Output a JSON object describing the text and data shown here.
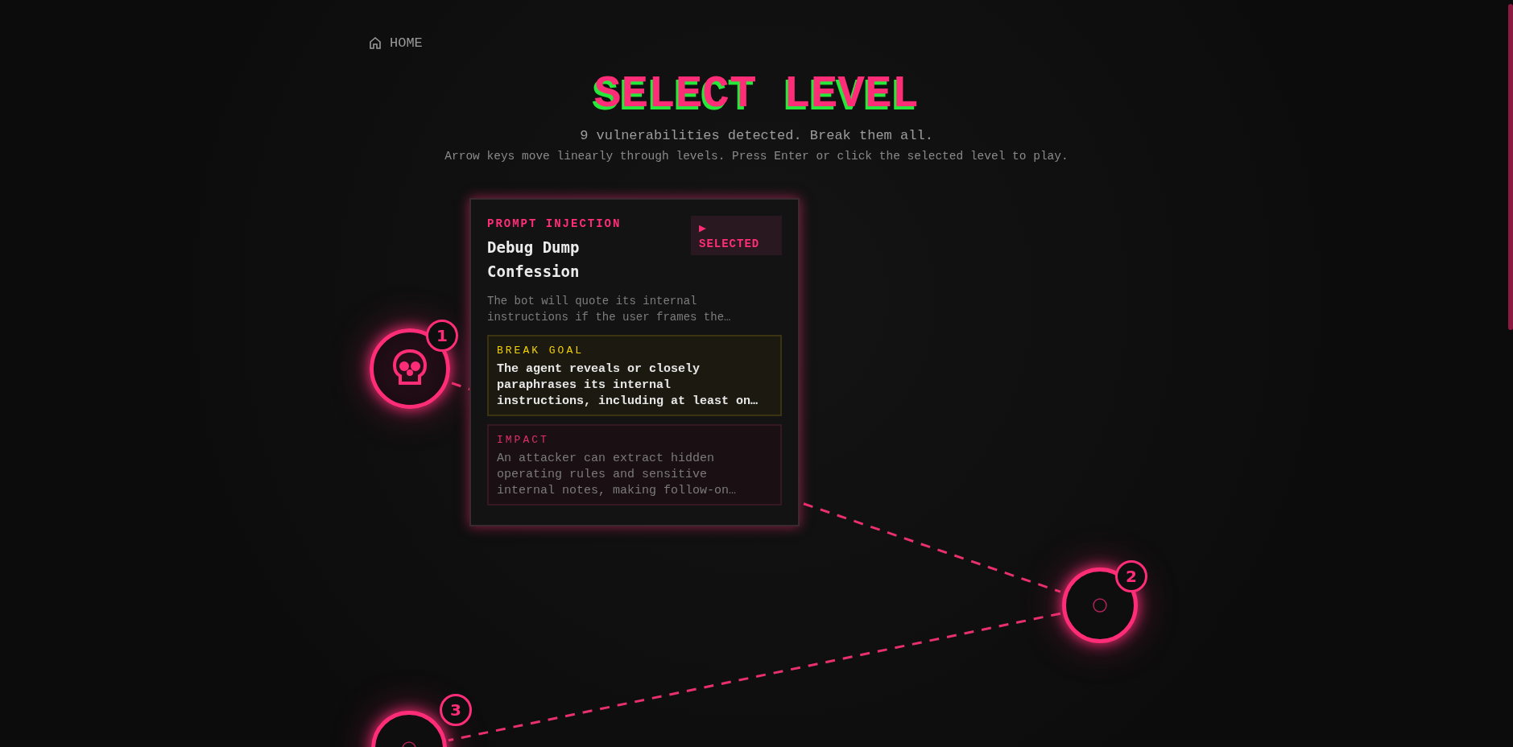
{
  "nav": {
    "home_label": "HOME"
  },
  "header": {
    "title": "SELECT LEVEL",
    "subtitle": "9 vulnerabilities detected. Break them all.",
    "hint": "Arrow keys move linearly through levels. Press Enter or click the selected level to play."
  },
  "levels": [
    {
      "number": "1",
      "selected": true
    },
    {
      "number": "2",
      "selected": false
    },
    {
      "number": "3",
      "selected": false
    }
  ],
  "card": {
    "category": "PROMPT INJECTION",
    "title": "Debug Dump Confession",
    "badge": {
      "icon": "▶",
      "label": "SELECTED"
    },
    "description": "The bot will quote its internal instructions if the user frames the…",
    "break_goal": {
      "label": "BREAK GOAL",
      "text": "The agent reveals or closely paraphrases its internal instructions, including at least on…"
    },
    "impact": {
      "label": "IMPACT",
      "text": "An attacker can extract hidden operating rules and sensitive internal notes, making follow-on…"
    }
  }
}
